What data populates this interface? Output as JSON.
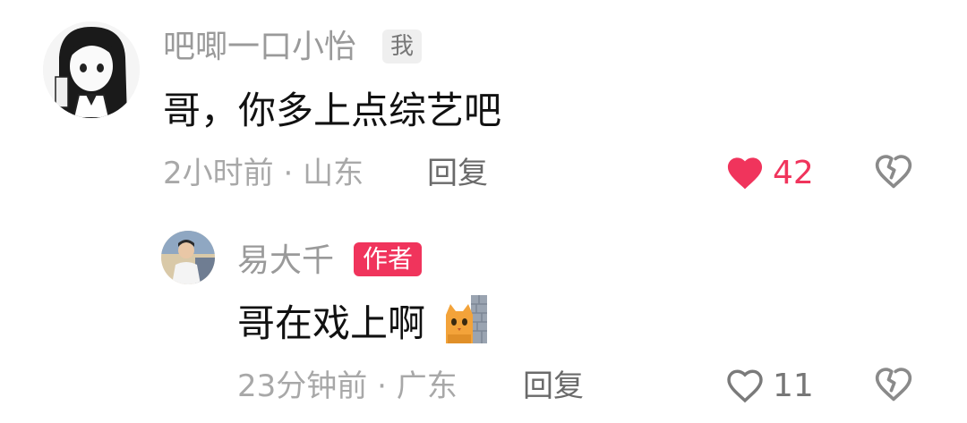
{
  "comment": {
    "username": "吧唧一口小怡",
    "badge": "我",
    "text": "哥，你多上点综艺吧",
    "time": "2小时前",
    "separator": " · ",
    "location": "山东",
    "reply_label": "回复",
    "like_count": "42",
    "liked": true,
    "icons": [
      "avatar",
      "heart-filled-icon",
      "broken-heart-icon"
    ]
  },
  "reply": {
    "username": "易大千",
    "badge": "作者",
    "text": "哥在戏上啊",
    "emoji": "cat-peeking-emoji",
    "time": "23分钟前",
    "separator": " · ",
    "location": "广东",
    "reply_label": "回复",
    "like_count": "11",
    "liked": false,
    "icons": [
      "avatar",
      "heart-outline-icon",
      "broken-heart-icon"
    ]
  },
  "colors": {
    "like_active": "#f0345c",
    "author_badge": "#f0345c",
    "muted_text": "#9a9a9a"
  }
}
